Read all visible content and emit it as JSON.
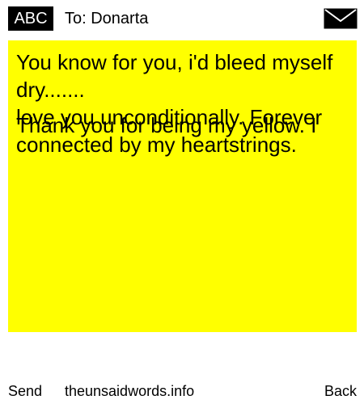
{
  "header": {
    "abc_label": "ABC",
    "to_label": "To: Donarta",
    "envelope_icon": "envelope-icon"
  },
  "note": {
    "background": "#ffff00",
    "message_a": [
      "You know for you, i'd bleed myself",
      "dry.......",
      "love you unconditionally. Forever",
      "connected by my heartstrings."
    ],
    "message_b": [
      "Thank you for being my yellow. I"
    ]
  },
  "footer": {
    "send_label": "Send",
    "site_label": "theunsaidwords.info",
    "back_label": "Back"
  }
}
